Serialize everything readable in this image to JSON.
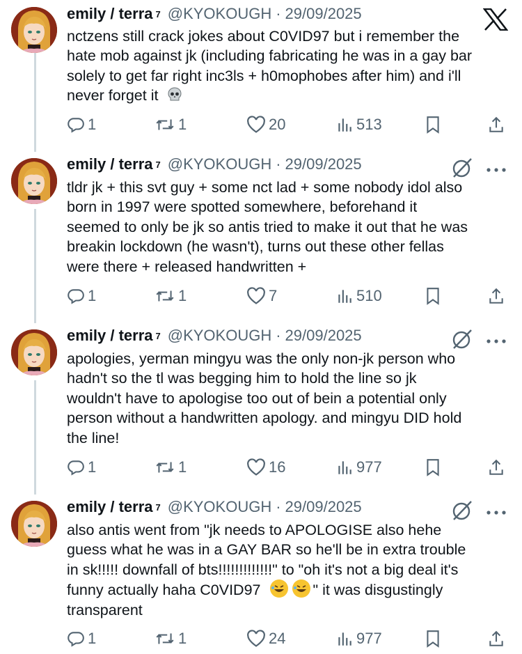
{
  "colors": {
    "text": "#0f1419",
    "muted": "#536471",
    "thread_line": "#cfd9de"
  },
  "tweets": [
    {
      "name": "emily / terra",
      "sup": "7",
      "handle": "@KYOKOUGH",
      "sep": "·",
      "date": "29/09/2025",
      "corner_icon": "x-logo-icon",
      "lines": [
        "nctzens still crack jokes about C0VID97 but i remember the",
        "hate mob against jk (including fabricating he was in a gay bar",
        "solely to get far right inc3ls + h0mophobes after him) and i'll",
        "never forget it"
      ],
      "end_emoji": "skull-emoji-icon",
      "replies": "1",
      "reposts": "1",
      "likes": "20",
      "views": "513"
    },
    {
      "name": "emily / terra",
      "sup": "7",
      "handle": "@KYOKOUGH",
      "sep": "·",
      "date": "29/09/2025",
      "corner_icon": "grok-icon",
      "lines": [
        "tldr jk + this svt guy + some nct lad + some nobody idol also",
        "born in 1997 were spotted somewhere, beforehand it",
        "seemed to only be jk so antis tried to make it out that he was",
        "breakin lockdown (he wasn't), turns out these other fellas",
        "were there + released handwritten +"
      ],
      "replies": "1",
      "reposts": "1",
      "likes": "7",
      "views": "510"
    },
    {
      "name": "emily / terra",
      "sup": "7",
      "handle": "@KYOKOUGH",
      "sep": "·",
      "date": "29/09/2025",
      "corner_icon": "grok-icon",
      "lines": [
        "apologies, yerman mingyu was the only non-jk person who",
        "hadn't so the tl was begging him to hold the line so jk",
        "wouldn't have to apologise too out of bein a potential only",
        "person without a handwritten apology. and mingyu DID hold",
        "the line!"
      ],
      "replies": "1",
      "reposts": "1",
      "likes": "16",
      "views": "977"
    },
    {
      "name": "emily / terra",
      "sup": "7",
      "handle": "@KYOKOUGH",
      "sep": "·",
      "date": "29/09/2025",
      "corner_icon": "grok-icon",
      "lines": [
        "also antis went from \"jk needs to APOLOGISE also hehe",
        "guess what he was in a GAY BAR so he'll be in extra trouble",
        "in sk!!!!! downfall of bts!!!!!!!!!!!!!\" to \"oh it's not a big deal it's",
        "funny actually haha C0VID97",
        "transparent"
      ],
      "line4_tail": "\" it was disgustingly",
      "line4_emojis": [
        "rofl-emoji-icon",
        "rofl-emoji-icon"
      ],
      "replies": "1",
      "reposts": "1",
      "likes": "24",
      "views": "977"
    }
  ]
}
